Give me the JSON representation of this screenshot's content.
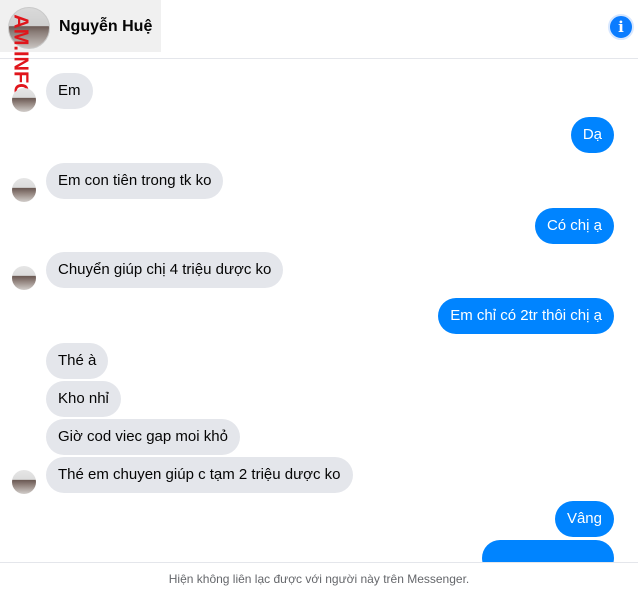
{
  "contact": {
    "name": "Nguyễn Huệ"
  },
  "watermark": {
    "text": "AM.INFO"
  },
  "header": {
    "info_icon": "i"
  },
  "messages": [
    {
      "dir": "in",
      "text": "Em"
    },
    {
      "dir": "out",
      "text": "Dạ"
    },
    {
      "dir": "in",
      "text": "Em con tiên trong tk ko"
    },
    {
      "dir": "out",
      "text": "Có chị ạ"
    },
    {
      "dir": "in",
      "text": "Chuyển giúp chị 4 triệu dược ko"
    },
    {
      "dir": "out",
      "text": "Em chỉ có 2tr thôi chị ạ"
    },
    {
      "dir": "in",
      "text": "Thé à"
    },
    {
      "dir": "in",
      "text": "Kho nhỉ"
    },
    {
      "dir": "in",
      "text": "Giờ cod viec gap moi khỏ"
    },
    {
      "dir": "in",
      "text": "Thé em chuyen giúp c tạm 2 triệu dược ko"
    },
    {
      "dir": "out",
      "text": "Vâng"
    },
    {
      "dir": "out",
      "text": ""
    }
  ],
  "footer": {
    "notice": "Hiện không liên lạc được với người này trên Messenger."
  },
  "colors": {
    "outgoing": "#0084ff",
    "incoming": "#e4e6eb",
    "watermark": "#e0151b"
  }
}
